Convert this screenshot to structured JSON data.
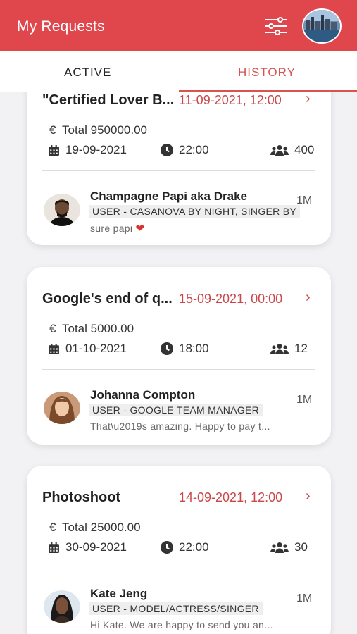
{
  "header": {
    "title": "My Requests",
    "filter_icon": "sliders-icon",
    "accent": "#e0474c"
  },
  "tabs": {
    "active_label": "ACTIVE",
    "history_label": "HISTORY"
  },
  "requests": [
    {
      "title": "\"Certified Lover B...",
      "created": "11-09-2021, 12:00",
      "total": "Total 950000.00",
      "event_date": "19-09-2021",
      "event_time": "22:00",
      "guests": "400",
      "person": {
        "name": "Champagne Papi aka Drake",
        "role": "USER - CASANOVA BY NIGHT, SINGER BY",
        "message": "sure papi",
        "ago": "1M"
      }
    },
    {
      "title": "Google's end of q...",
      "created": "15-09-2021, 00:00",
      "total": "Total 5000.00",
      "event_date": "01-10-2021",
      "event_time": "18:00",
      "guests": "12",
      "person": {
        "name": "Johanna Compton",
        "role": "USER - GOOGLE TEAM MANAGER",
        "message": "That\\u2019s amazing. Happy to pay t...",
        "ago": "1M"
      }
    },
    {
      "title": "Photoshoot",
      "created": "14-09-2021, 12:00",
      "total": "Total 25000.00",
      "event_date": "30-09-2021",
      "event_time": "22:00",
      "guests": "30",
      "person": {
        "name": "Kate Jeng",
        "role": "USER - MODEL/ACTRESS/SINGER",
        "message": "Hi Kate. We are happy to send you an...",
        "ago": "1M"
      }
    }
  ]
}
